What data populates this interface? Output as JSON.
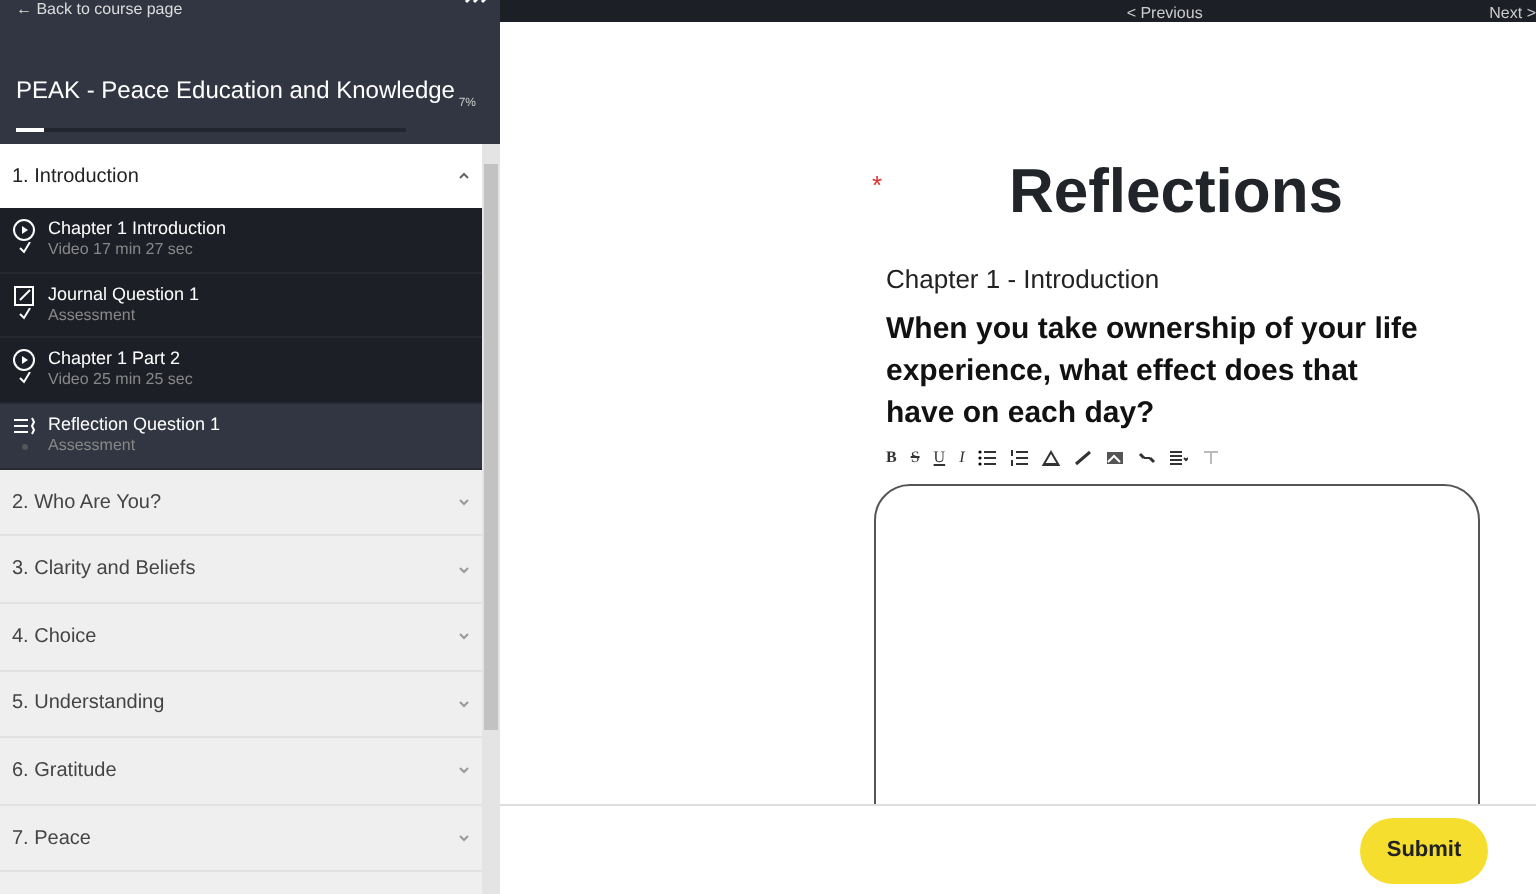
{
  "sidebar": {
    "back_link": "← Back to course page",
    "course_title": "PEAK - Peace Education and Knowledge",
    "progress": {
      "level": 0.07,
      "reading": "7%"
    },
    "sections": [
      {
        "title": "1. Introduction",
        "expanded": true,
        "lessons": [
          {
            "kind": "video",
            "title": "Chapter 1 Introduction",
            "subtitle": "Video 17 min 27 sec",
            "completed": true,
            "selected": false
          },
          {
            "kind": "journal",
            "title": "Journal Question 1",
            "subtitle": "Assessment",
            "completed": true,
            "selected": false
          },
          {
            "kind": "video",
            "title": "Chapter 1 Part 2",
            "subtitle": "Video 25 min 25 sec",
            "completed": true,
            "selected": false
          },
          {
            "kind": "reflection",
            "title": "Reflection Question 1",
            "subtitle": "Assessment",
            "completed": false,
            "selected": true
          }
        ]
      },
      {
        "title": "2. Who Are You?",
        "expanded": false
      },
      {
        "title": "3. Clarity and Beliefs",
        "expanded": false
      },
      {
        "title": "4. Choice",
        "expanded": false
      },
      {
        "title": "5. Understanding",
        "expanded": false
      },
      {
        "title": "6. Gratitude",
        "expanded": false
      },
      {
        "title": "7. Peace",
        "expanded": false
      }
    ]
  },
  "topbar": {
    "previous": "< Previous",
    "next": "Next >"
  },
  "content": {
    "required_mark": "*",
    "title": "Reflections",
    "chapter": "Chapter 1 - Introduction",
    "question": "When you take ownership of your life experience, what effect does that have on each day?",
    "toolbar": [
      {
        "kind": "bold",
        "label": "B"
      },
      {
        "kind": "strike",
        "label": "S"
      },
      {
        "kind": "underline",
        "label": "U"
      },
      {
        "kind": "italic",
        "label": "I"
      },
      {
        "kind": "bullets"
      },
      {
        "kind": "numbers"
      },
      {
        "kind": "color"
      },
      {
        "kind": "pen"
      },
      {
        "kind": "image"
      },
      {
        "kind": "link"
      },
      {
        "kind": "align"
      },
      {
        "kind": "clear"
      }
    ]
  },
  "footer": {
    "submit": "Submit"
  }
}
